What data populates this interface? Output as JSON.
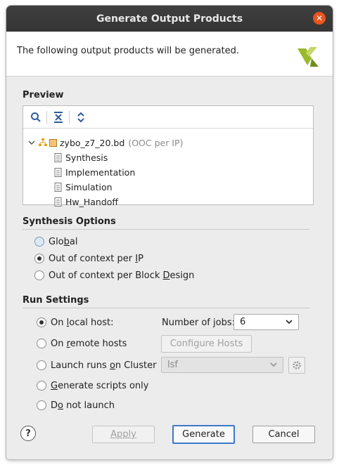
{
  "window": {
    "title": "Generate Output Products"
  },
  "header": {
    "description": "The following output products will be generated."
  },
  "preview": {
    "title": "Preview",
    "root": {
      "name": "zybo_z7_20.bd",
      "suffix": "(OOC per IP)"
    },
    "children": [
      "Synthesis",
      "Implementation",
      "Simulation",
      "Hw_Handoff"
    ]
  },
  "synthesis": {
    "title": "Synthesis Options",
    "options": [
      {
        "pre": "Glo",
        "u": "b",
        "post": "al",
        "selected": false
      },
      {
        "pre": "Out of context per ",
        "u": "I",
        "post": "P",
        "selected": true
      },
      {
        "pre": "Out of context per Block ",
        "u": "D",
        "post": "esign",
        "selected": false
      }
    ]
  },
  "run": {
    "title": "Run Settings",
    "local": {
      "pre": "On ",
      "u": "l",
      "post": "ocal host:"
    },
    "remote": {
      "pre": "On ",
      "u": "r",
      "post": "emote hosts"
    },
    "cluster": {
      "pre": "Launch runs ",
      "u": "o",
      "post": "n Cluster"
    },
    "scripts": {
      "pre": "",
      "u": "G",
      "post": "enerate scripts only"
    },
    "nolaunch": {
      "pre": "D",
      "u": "o",
      "post": " not launch"
    },
    "jobs_label": "Number of jobs:",
    "jobs_value": "6",
    "configure_hosts": "Configure Hosts",
    "cluster_value": "lsf"
  },
  "buttons": {
    "help": "?",
    "apply": "Apply",
    "generate": "Generate",
    "cancel": "Cancel"
  },
  "colors": {
    "accent": "#3f78c9",
    "logo": "#9aba2b",
    "close": "#e9541e"
  }
}
